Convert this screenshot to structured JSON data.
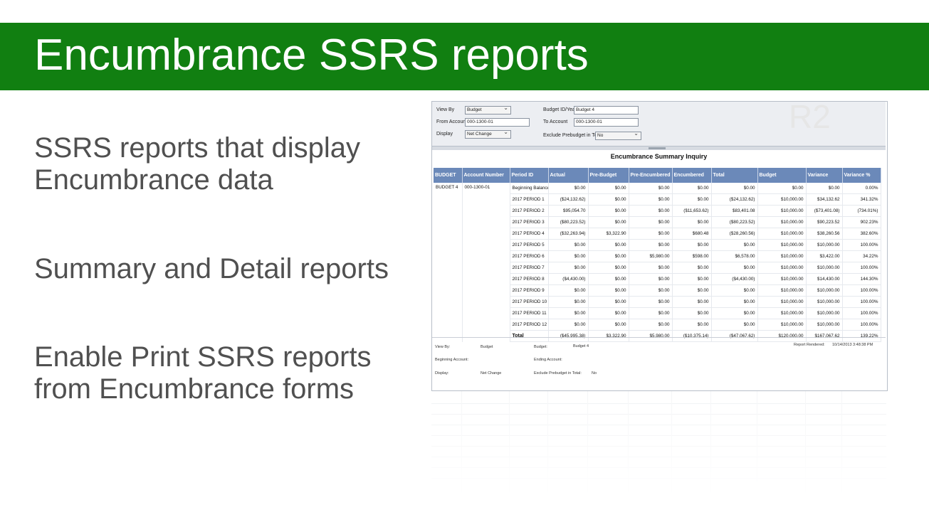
{
  "slide": {
    "title": "Encumbrance SSRS reports",
    "bullets": [
      "SSRS reports that display Encumbrance data",
      "Summary and Detail reports",
      "Enable Print SSRS reports from Encumbrance forms"
    ],
    "badge": "R2",
    "colors": {
      "banner": "#117f11",
      "header_row": "#6b89b9",
      "bullet_text": "#505050"
    }
  },
  "params": {
    "view_by_label": "View By",
    "view_by_value": "Budget",
    "budget_id_label": "Budget ID/Year",
    "budget_id_value": "Budget 4",
    "from_account_label": "From Account",
    "from_account_value": "000-1300-01",
    "to_account_label": "To Account",
    "to_account_value": "000-1300-01",
    "display_label": "Display",
    "display_value": "Net Change",
    "exclude_label": "Exclude Prebudget in Total",
    "exclude_value": "No"
  },
  "report": {
    "title": "Encumbrance Summary Inquiry",
    "columns": [
      "BUDGET",
      "Account Number",
      "Period ID",
      "Actual",
      "Pre-Budget",
      "Pre-Encumbered",
      "Encumbered",
      "Total",
      "Budget",
      "Variance",
      "Variance %"
    ],
    "budget": "BUDGET 4",
    "account": "000-1300-01",
    "rows": [
      [
        "Beginning Balances",
        "$0.00",
        "$0.00",
        "$0.00",
        "$0.00",
        "$0.00",
        "$0.00",
        "$0.00",
        "0.00%"
      ],
      [
        "2017 PERIOD 1",
        "($24,132.62)",
        "$0.00",
        "$0.00",
        "$0.00",
        "($24,132.62)",
        "$10,000.00",
        "$34,132.62",
        "341.32%"
      ],
      [
        "2017 PERIOD 2",
        "$95,054.70",
        "$0.00",
        "$0.00",
        "($11,653.62)",
        "$83,401.08",
        "$10,000.00",
        "($73,401.08)",
        "(734.01%)"
      ],
      [
        "2017 PERIOD 3",
        "($80,223.52)",
        "$0.00",
        "$0.00",
        "$0.00",
        "($80,223.52)",
        "$10,000.00",
        "$90,223.52",
        "902.23%"
      ],
      [
        "2017 PERIOD 4",
        "($32,263.94)",
        "$3,322.90",
        "$0.00",
        "$680.48",
        "($28,260.56)",
        "$10,000.00",
        "$38,260.56",
        "382.60%"
      ],
      [
        "2017 PERIOD 5",
        "$0.00",
        "$0.00",
        "$0.00",
        "$0.00",
        "$0.00",
        "$10,000.00",
        "$10,000.00",
        "100.00%"
      ],
      [
        "2017 PERIOD 6",
        "$0.00",
        "$0.00",
        "$5,980.00",
        "$598.00",
        "$6,578.00",
        "$10,000.00",
        "$3,422.00",
        "34.22%"
      ],
      [
        "2017 PERIOD 7",
        "$0.00",
        "$0.00",
        "$0.00",
        "$0.00",
        "$0.00",
        "$10,000.00",
        "$10,000.00",
        "100.00%"
      ],
      [
        "2017 PERIOD 8",
        "($4,430.00)",
        "$0.00",
        "$0.00",
        "$0.00",
        "($4,430.00)",
        "$10,000.00",
        "$14,430.00",
        "144.30%"
      ],
      [
        "2017 PERIOD 9",
        "$0.00",
        "$0.00",
        "$0.00",
        "$0.00",
        "$0.00",
        "$10,000.00",
        "$10,000.00",
        "100.00%"
      ],
      [
        "2017 PERIOD 10",
        "$0.00",
        "$0.00",
        "$0.00",
        "$0.00",
        "$0.00",
        "$10,000.00",
        "$10,000.00",
        "100.00%"
      ],
      [
        "2017 PERIOD 11",
        "$0.00",
        "$0.00",
        "$0.00",
        "$0.00",
        "$0.00",
        "$10,000.00",
        "$10,000.00",
        "100.00%"
      ],
      [
        "2017 PERIOD 12",
        "$0.00",
        "$0.00",
        "$0.00",
        "$0.00",
        "$0.00",
        "$10,000.00",
        "$10,000.00",
        "100.00%"
      ]
    ],
    "total": [
      "Total",
      "($45,995.38)",
      "$3,322.90",
      "$5,980.00",
      "($10,375.14)",
      "($47,067.62)",
      "$120,000.00",
      "$167,067.62",
      "139.22%"
    ]
  },
  "footer": {
    "view_by_label": "View By:",
    "view_by_value": "Budget",
    "budget_label": "Budget:",
    "budget_value": "Budget 4",
    "report_rendered_label": "Report Rendered:",
    "report_rendered_value": "10/14/2013 3:48:38 PM",
    "beginning_account_label": "Beginning Account:",
    "ending_account_label": "Ending Account:",
    "display_label": "Display:",
    "display_value": "Net Change",
    "exclude_label": "Exclude Prebudget in Total:",
    "exclude_value": "No"
  }
}
